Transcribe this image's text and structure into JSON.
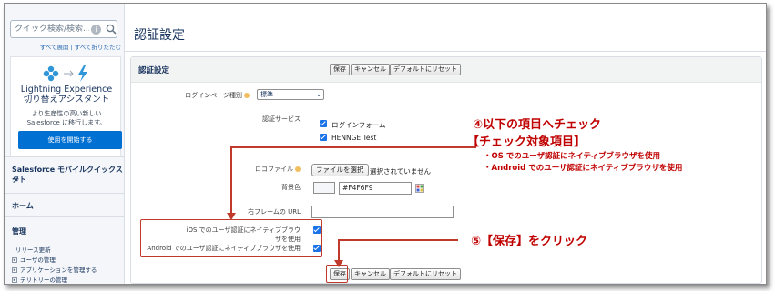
{
  "sidebar": {
    "search_placeholder": "クイック検索/検索...",
    "expand_all": "すべて展開",
    "collapse_all": "すべて折りたたむ",
    "link_sep": "|",
    "lex": {
      "title_line1": "Lightning Experience",
      "title_line2": "切り替えアシスタント",
      "desc_line1": "より生産性の高い新しい",
      "desc_line2": "Salesforce に移行します。",
      "button": "使用を開始する"
    },
    "sections": [
      "Salesforce モバイルクイックスタ",
      "ート",
      "ホーム",
      "管理"
    ],
    "release_notes": "リリース更新",
    "sub_items": [
      "ユーザの管理",
      "アプリケーションを管理する",
      "テリトリーの管理"
    ]
  },
  "page": {
    "title": "認証設定",
    "panel_title": "認証設定",
    "buttons": {
      "save": "保存",
      "cancel": "キャンセル",
      "reset": "デフォルトにリセット"
    }
  },
  "form": {
    "login_page_type_label": "ログインページ種別",
    "login_page_type_value": "標準",
    "auth_service_label": "認証サービス",
    "auth_services": [
      "ログインフォーム",
      "HENNGE Test"
    ],
    "logo_file_label": "ロゴファイル",
    "choose_file": "ファイルを選択",
    "no_file": "選択されていません",
    "bg_color_label": "背景色",
    "bg_color_value": "#F4F6F9",
    "right_frame_label": "右フレームの URL",
    "ios_label": "iOS でのユーザ認証にネイティブブラウザを使用",
    "android_label": "Android でのユーザ認証にネイティブブラウザを使用"
  },
  "annotations": {
    "step4": "④以下の項目へチェック",
    "step4_sub": "【チェック対象項目】",
    "step4_item1": "・OS でのユーザ認証にネイティブブラウザを使用",
    "step4_item2": "・Android でのユーザ認証にネイティブブラウザを使用",
    "step5": "⑤【保存】をクリック"
  },
  "colors": {
    "accent_blue": "#0070d2",
    "annotation_red": "#c00000",
    "checkbox_blue": "#1b73e8"
  }
}
